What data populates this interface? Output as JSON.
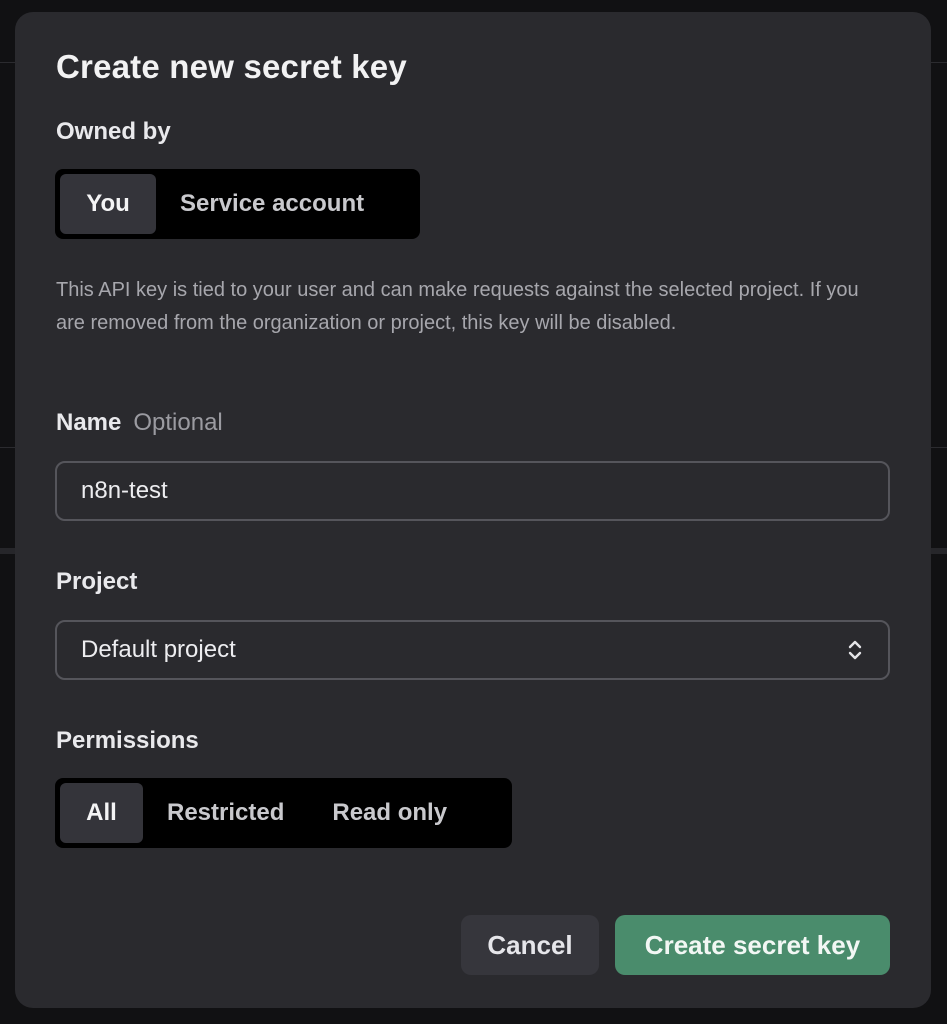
{
  "dialog": {
    "title": "Create new secret key"
  },
  "owned_by": {
    "label": "Owned by",
    "options": [
      "You",
      "Service account"
    ],
    "selected": "You"
  },
  "description": "This API key is tied to your user and can make requests against the selected project. If you are removed from the organization or project, this key will be disabled.",
  "name_field": {
    "label": "Name",
    "optional_label": "Optional",
    "value": "n8n-test"
  },
  "project_field": {
    "label": "Project",
    "selected": "Default project",
    "icon": "chevron-up-down-icon"
  },
  "permissions": {
    "label": "Permissions",
    "options": [
      "All",
      "Restricted",
      "Read only"
    ],
    "selected": "All"
  },
  "actions": {
    "cancel_label": "Cancel",
    "create_label": "Create secret key"
  },
  "colors": {
    "modal_bg": "#2a2a2e",
    "segment_bg": "#000000",
    "segment_active": "#34343a",
    "primary_button": "#4a8c6c",
    "secondary_button": "#36363c"
  }
}
